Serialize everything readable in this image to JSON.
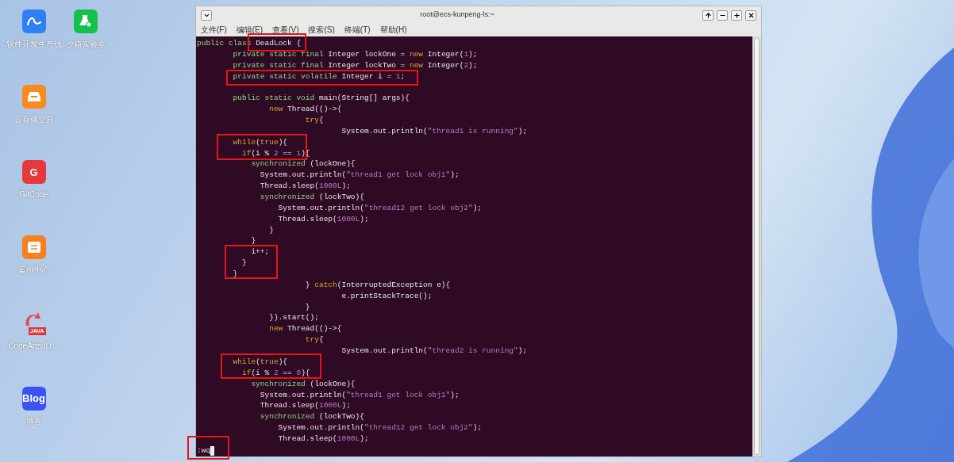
{
  "desktop_icons": [
    {
      "label": "软件开发生产线",
      "kind": "pipeline",
      "color": "#2f7ff5"
    },
    {
      "label": "云存储空间",
      "kind": "storage",
      "color": "#f98a1c"
    },
    {
      "label": "GitCode",
      "kind": "letter",
      "color": "#e5393c",
      "glyph": "G"
    },
    {
      "label": "案例中心",
      "kind": "document",
      "color": "#fa7f1d"
    },
    {
      "label": "CodeArts ID…",
      "kind": "java",
      "color": "#e8464e",
      "glyph": "JAVA"
    },
    {
      "label": "博客",
      "kind": "letter",
      "color": "#3c52f2",
      "glyph": "Blog"
    },
    {
      "label": "沙箱实验室",
      "kind": "lab",
      "color": "#12c24a"
    }
  ],
  "window": {
    "title": "root@ecs-kunpeng-ls:~",
    "menu": [
      "文件(F)",
      "编辑(E)",
      "查看(V)",
      "搜索(S)",
      "终端(T)",
      "帮助(H)"
    ],
    "code_lines": [
      {
        "tokens": [
          {
            "text": "public class ",
            "kind": "kw"
          },
          {
            "text": "DeadLock {",
            "kind": "plain"
          }
        ]
      },
      {
        "tokens": [
          {
            "text": "        private static final",
            "kind": "kw"
          },
          {
            "text": " Integer lockOne = ",
            "kind": "plain"
          },
          {
            "text": "new",
            "kind": "ctl"
          },
          {
            "text": " Integer(",
            "kind": "plain"
          },
          {
            "text": "1",
            "kind": "lit"
          },
          {
            "text": ");",
            "kind": "plain"
          }
        ]
      },
      {
        "tokens": [
          {
            "text": "        private static final",
            "kind": "kw"
          },
          {
            "text": " Integer lockTwo = ",
            "kind": "plain"
          },
          {
            "text": "new",
            "kind": "ctl"
          },
          {
            "text": " Integer(",
            "kind": "plain"
          },
          {
            "text": "2",
            "kind": "lit"
          },
          {
            "text": ");",
            "kind": "plain"
          }
        ]
      },
      {
        "tokens": [
          {
            "text": "        private static volatile",
            "kind": "kw"
          },
          {
            "text": " Integer i = ",
            "kind": "plain"
          },
          {
            "text": "1",
            "kind": "lit"
          },
          {
            "text": ";",
            "kind": "plain"
          }
        ]
      },
      {
        "blank_line_before": true,
        "tokens": [
          {
            "text": "        public static void",
            "kind": "kw"
          },
          {
            "text": " main(String[] args){",
            "kind": "plain"
          }
        ]
      },
      {
        "tokens": [
          {
            "text": "                new",
            "kind": "ctl"
          },
          {
            "text": " Thread(()->{",
            "kind": "plain"
          }
        ]
      },
      {
        "tokens": [
          {
            "text": "                        try",
            "kind": "ctl"
          },
          {
            "text": "{",
            "kind": "plain"
          }
        ]
      },
      {
        "tokens": [
          {
            "text": "                                System.out.println(",
            "kind": "plain"
          },
          {
            "text": "\"thread1 is running\"",
            "kind": "lit"
          },
          {
            "text": ");",
            "kind": "plain"
          }
        ]
      },
      {
        "tokens": [
          {
            "text": "        while",
            "kind": "ctl"
          },
          {
            "text": "(",
            "kind": "plain"
          },
          {
            "text": "true",
            "kind": "ctl"
          },
          {
            "text": "){",
            "kind": "plain"
          }
        ]
      },
      {
        "tokens": [
          {
            "text": "          if",
            "kind": "ctl"
          },
          {
            "text": "(i % ",
            "kind": "plain"
          },
          {
            "text": "2",
            "kind": "lit"
          },
          {
            "text": " == ",
            "kind": "plain"
          },
          {
            "text": "1",
            "kind": "lit"
          },
          {
            "text": "){",
            "kind": "plain"
          }
        ]
      },
      {
        "tokens": [
          {
            "text": "            synchronized",
            "kind": "kw"
          },
          {
            "text": " (lockOne){",
            "kind": "plain"
          }
        ]
      },
      {
        "tokens": [
          {
            "text": "              System.out.println(",
            "kind": "plain"
          },
          {
            "text": "\"thread1 get lock obj1\"",
            "kind": "lit"
          },
          {
            "text": ");",
            "kind": "plain"
          }
        ]
      },
      {
        "tokens": [
          {
            "text": "              Thread.sleep(",
            "kind": "plain"
          },
          {
            "text": "1000L",
            "kind": "lit"
          },
          {
            "text": ");",
            "kind": "plain"
          }
        ]
      },
      {
        "tokens": [
          {
            "text": "              synchronized",
            "kind": "kw"
          },
          {
            "text": " (lockTwo){",
            "kind": "plain"
          }
        ]
      },
      {
        "tokens": [
          {
            "text": "                  System.out.println(",
            "kind": "plain"
          },
          {
            "text": "\"thread12 get lock obj2\"",
            "kind": "lit"
          },
          {
            "text": ");",
            "kind": "plain"
          }
        ]
      },
      {
        "tokens": [
          {
            "text": "                  Thread.sleep(",
            "kind": "plain"
          },
          {
            "text": "1000L",
            "kind": "lit"
          },
          {
            "text": ");",
            "kind": "plain"
          }
        ]
      },
      {
        "tokens": [
          {
            "text": "                }",
            "kind": "plain"
          }
        ]
      },
      {
        "tokens": [
          {
            "text": "            }",
            "kind": "plain"
          }
        ]
      },
      {
        "tokens": [
          {
            "text": "            i++;",
            "kind": "plain"
          }
        ]
      },
      {
        "tokens": [
          {
            "text": "          }",
            "kind": "plain"
          }
        ]
      },
      {
        "tokens": [
          {
            "text": "        }",
            "kind": "plain"
          }
        ]
      },
      {
        "tokens": [
          {
            "text": "                        } ",
            "kind": "plain"
          },
          {
            "text": "catch",
            "kind": "ctl"
          },
          {
            "text": "(InterruptedException e){",
            "kind": "plain"
          }
        ]
      },
      {
        "tokens": [
          {
            "text": "                                e.printStackTrace();",
            "kind": "plain"
          }
        ]
      },
      {
        "tokens": [
          {
            "text": "                        }",
            "kind": "plain"
          }
        ]
      },
      {
        "tokens": [
          {
            "text": "                }).start();",
            "kind": "plain"
          }
        ]
      },
      {
        "tokens": [
          {
            "text": "                new",
            "kind": "ctl"
          },
          {
            "text": " Thread(()->{",
            "kind": "plain"
          }
        ]
      },
      {
        "tokens": [
          {
            "text": "                        try",
            "kind": "ctl"
          },
          {
            "text": "{",
            "kind": "plain"
          }
        ]
      },
      {
        "tokens": [
          {
            "text": "                                System.out.println(",
            "kind": "plain"
          },
          {
            "text": "\"thread2 is running\"",
            "kind": "lit"
          },
          {
            "text": ");",
            "kind": "plain"
          }
        ]
      },
      {
        "tokens": [
          {
            "text": "        while",
            "kind": "ctl"
          },
          {
            "text": "(",
            "kind": "plain"
          },
          {
            "text": "true",
            "kind": "ctl"
          },
          {
            "text": "){",
            "kind": "plain"
          }
        ]
      },
      {
        "tokens": [
          {
            "text": "          if",
            "kind": "ctl"
          },
          {
            "text": "(i % ",
            "kind": "plain"
          },
          {
            "text": "2",
            "kind": "lit"
          },
          {
            "text": " == ",
            "kind": "plain"
          },
          {
            "text": "0",
            "kind": "lit"
          },
          {
            "text": "){",
            "kind": "plain"
          }
        ]
      },
      {
        "tokens": [
          {
            "text": "            synchronized",
            "kind": "kw"
          },
          {
            "text": " (lockOne){",
            "kind": "plain"
          }
        ]
      },
      {
        "tokens": [
          {
            "text": "              System.out.println(",
            "kind": "plain"
          },
          {
            "text": "\"thread1 get lock obj1\"",
            "kind": "lit"
          },
          {
            "text": ");",
            "kind": "plain"
          }
        ]
      },
      {
        "tokens": [
          {
            "text": "              Thread.sleep(",
            "kind": "plain"
          },
          {
            "text": "1000L",
            "kind": "lit"
          },
          {
            "text": ");",
            "kind": "plain"
          }
        ]
      },
      {
        "tokens": [
          {
            "text": "              synchronized",
            "kind": "kw"
          },
          {
            "text": " (lockTwo){",
            "kind": "plain"
          }
        ]
      },
      {
        "tokens": [
          {
            "text": "                  System.out.println(",
            "kind": "plain"
          },
          {
            "text": "\"thread12 get lock obj2\"",
            "kind": "lit"
          },
          {
            "text": ");",
            "kind": "plain"
          }
        ]
      },
      {
        "tokens": [
          {
            "text": "                  Thread.sleep(",
            "kind": "plain"
          },
          {
            "text": "1000L",
            "kind": "lit"
          },
          {
            "text": ");",
            "kind": "plain"
          }
        ]
      }
    ],
    "command_line": ":wq"
  }
}
